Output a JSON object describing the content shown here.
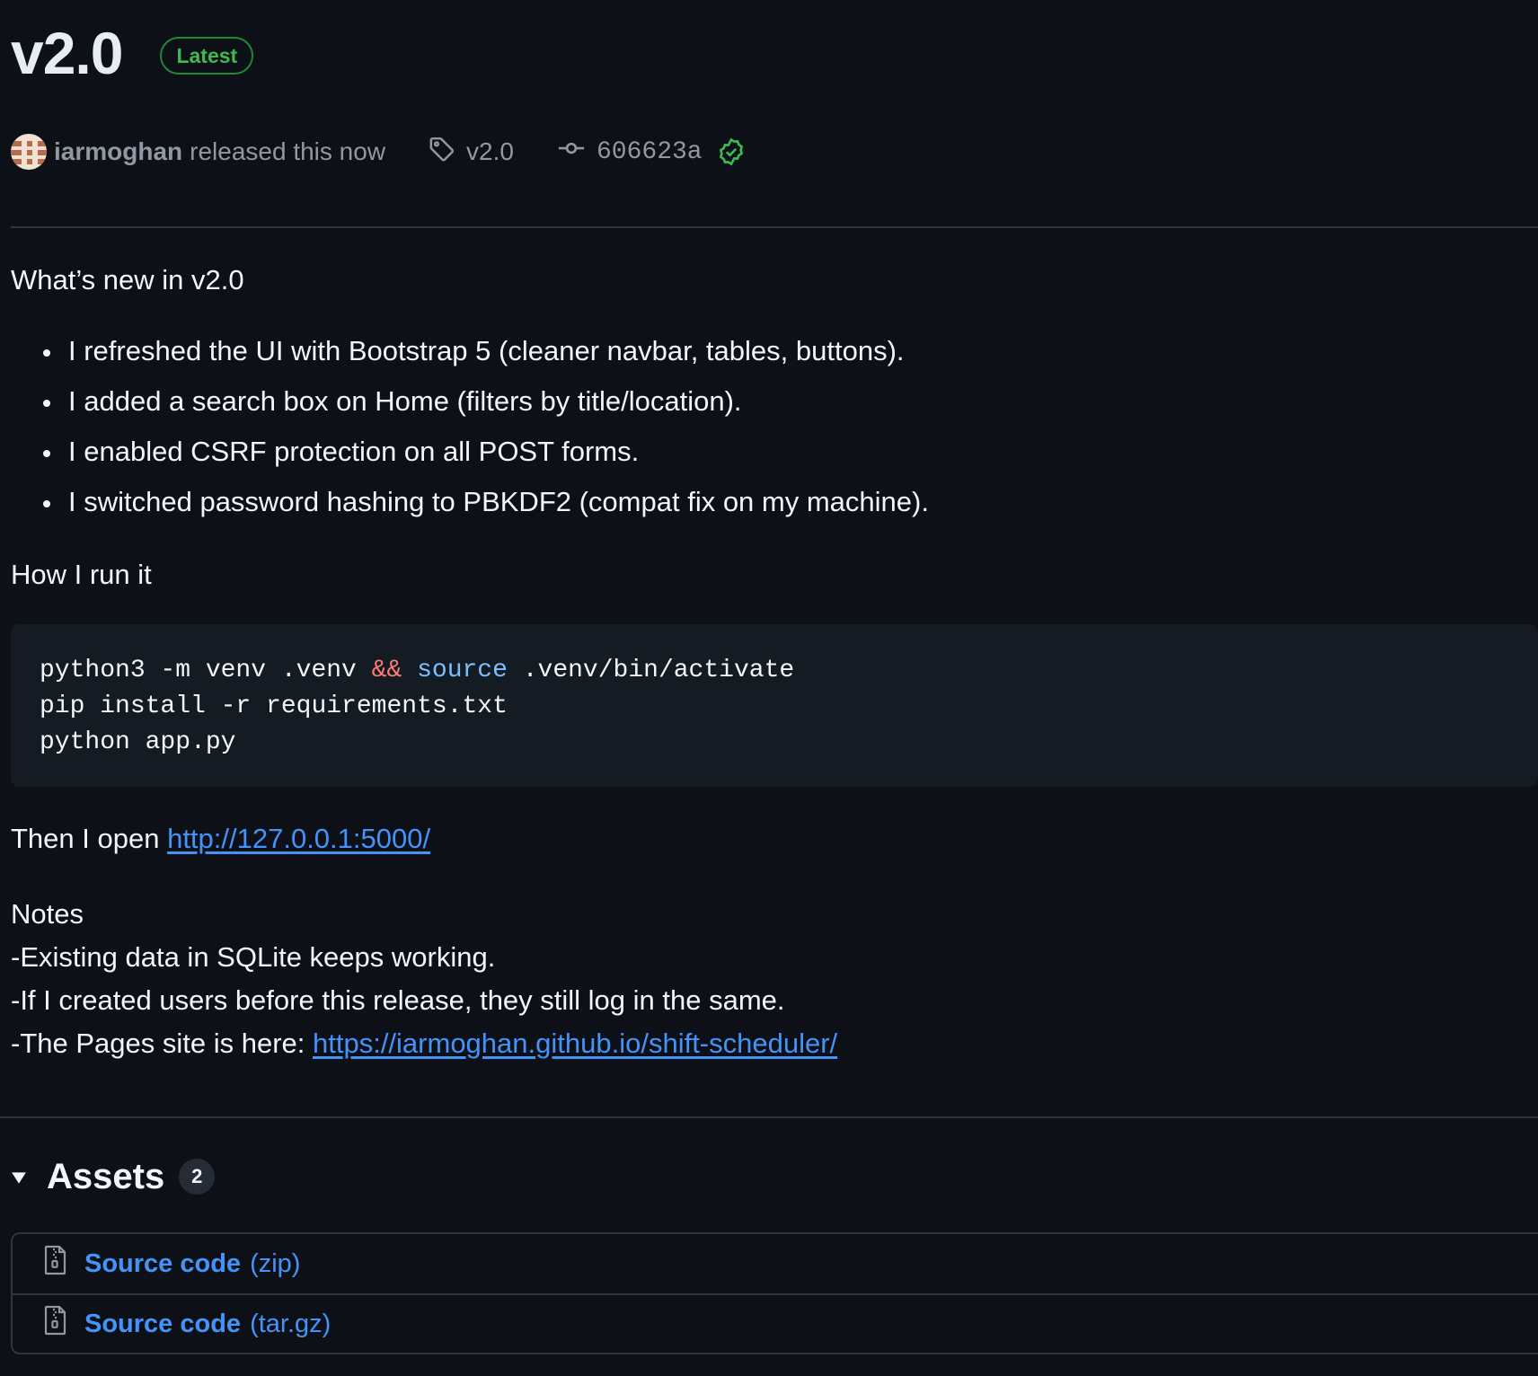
{
  "release": {
    "title": "v2.0",
    "badge": "Latest",
    "author": "iarmoghan",
    "released_text": "released this now",
    "tag": "v2.0",
    "commit": "606623a",
    "icons": {
      "tag": "tag-icon",
      "commit": "git-commit-icon",
      "verified": "verified-check-icon"
    }
  },
  "notes": {
    "whats_new_heading": "What’s new in v2.0",
    "changes": [
      "I refreshed the UI with Bootstrap 5 (cleaner navbar, tables, buttons).",
      "I added a search box on Home (filters by title/location).",
      "I enabled CSRF protection on all POST forms.",
      "I switched password hashing to PBKDF2 (compat fix on my machine)."
    ],
    "how_run_heading": "How I run it",
    "code": {
      "line1": {
        "a": "python3 -m venv .venv ",
        "op": "&&",
        "builtin": "source",
        "b": " .venv/bin/activate"
      },
      "line2": "pip install -r requirements.txt",
      "line3": "python app.py"
    },
    "then_open_text": "Then I open ",
    "local_url": "http://127.0.0.1:5000/",
    "notes_heading": "Notes",
    "note_lines": [
      "-Existing data in SQLite keeps working.",
      "-If I created users before this release, they still log in the same."
    ],
    "pages_prefix": "-The Pages site is here: ",
    "pages_url": "https://iarmoghan.github.io/shift-scheduler/"
  },
  "assets": {
    "title": "Assets",
    "count": "2",
    "items": [
      {
        "name": "Source code",
        "ext": "(zip)",
        "icon": "file-zip-icon"
      },
      {
        "name": "Source code",
        "ext": "(tar.gz)",
        "icon": "file-zip-icon"
      }
    ]
  },
  "colors": {
    "background": "#0d1117",
    "text": "#f0f6fc",
    "muted": "#9198a1",
    "link": "#4493f8",
    "success": "#3fb950",
    "border": "#30363d"
  }
}
